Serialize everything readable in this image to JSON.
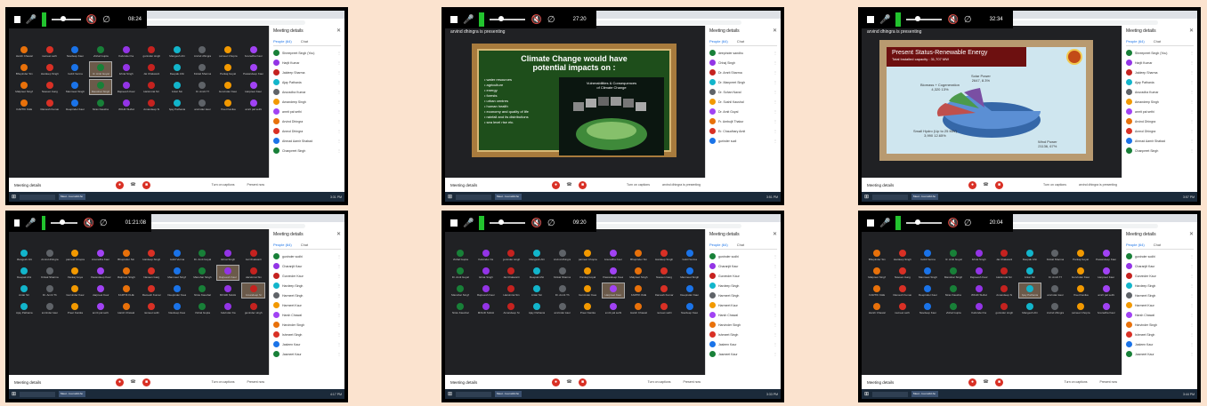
{
  "page": {
    "background": "#fbe3cf"
  },
  "browser": {
    "tab_title": "Meet - ku-nwdd-ho"
  },
  "common": {
    "meeting_details": "Meeting details",
    "people_tab": "People (64)",
    "chat_tab": "Chat",
    "turn_on_captions": "Turn on captions",
    "present_now": "Present now",
    "taskbar_app": "Meet - ku-nwdd-ho"
  },
  "screens": [
    {
      "id": "s1",
      "timer": "08:24",
      "time": "3:31 PM"
    },
    {
      "id": "s2",
      "timer": "27:20",
      "time": "3:51 PM",
      "presenter": "arvind dhingra is presenting",
      "presenting_label": "arvind dhingra is presenting"
    },
    {
      "id": "s3",
      "timer": "32:34",
      "time": "3:57 PM",
      "presenter": "arvind dhingra is presenting",
      "presenting_label": "arvind dhingra is presenting"
    },
    {
      "id": "s4",
      "timer": "01:21:08",
      "time": "4:17 PM"
    },
    {
      "id": "s5",
      "timer": "09:20",
      "time": "3:33 PM"
    },
    {
      "id": "s6",
      "timer": "20:04",
      "time": "3:44 PM"
    }
  ],
  "participants_grid": [
    "Harsh Chawal",
    "ravneet sethi",
    "Navdeep Kaur",
    "Vishal Gupta",
    "Kalvinder Ka",
    "guninder singh",
    "Mangesh Ahi",
    "Arvind dhingra",
    "parneet Chopra",
    "Anuradha Kaur",
    "Bhupinder Sin",
    "Hardeep Singh",
    "Gobil Verma",
    "Dr. Amit Goyal",
    "Ishrat Singh",
    "Jai Chakwarti",
    "Deepak Ahir",
    "Kinkal Sharma",
    "Pankaj Goyal",
    "Pawandeep Kaur",
    "Malpreet Singh",
    "Naveen Garg",
    "Manmeet Singh",
    "Manohar Singh",
    "Rajneesh Kaur",
    "Harsimrat Sin",
    "Antar Sin",
    "Dr. Amrit Th",
    "Gurvinder Kaur",
    "Harpreet Kaur",
    "KARTIK KHE",
    "Ramesh Kumar",
    "Deepinder Kaur",
    "Nirav Kaushal",
    "MOHD SHAH",
    "Amandeep Si",
    "Ajay Pathania",
    "amrinder kaur",
    "Preet Kanika",
    "amrit pal sethi"
  ],
  "sidebar_people": [
    "Shreepreet Singh (You)",
    "Harjit Kumar",
    "Jaideep Sharma",
    "Ajay Pathania",
    "Anuradha Kumar",
    "Amandeep Singh",
    "amrit pal sethi",
    "Arvind Dhingra",
    "Anmol Dhingra",
    "Ahmad Aamir Shabad",
    "Chanpreet Singh"
  ],
  "sidebar_people_s2": [
    "deepinder sandhu",
    "Chhaj Singh",
    "Dr. Amrit Sharma",
    "Dr. Manpreet Singh",
    "Dr. Sohan Naval",
    "Dr. Sushil Kaushal",
    "Dr. Amit Goyal",
    "Fr. Ambujit Thakur",
    "Er. Chaudhary Amit",
    "gurinder sudi"
  ],
  "sidebar_people_s5": [
    "guninder sodhi",
    "Charanjit Kaur",
    "Gurvinder Kaur",
    "Hardeep Singh",
    "Harmeet Singh",
    "Harmeet Kaur",
    "Harsh Chawal",
    "Harvinder Singh",
    "Ishmeet Singh",
    "Jasleen Kaur",
    "Jasmeet Kaur"
  ],
  "slide_climate": {
    "title_line1": "Climate Change would have",
    "title_line2": "potential  impacts on :",
    "items": [
      "water resources",
      "agriculture",
      "energy",
      "forests",
      "urban centres",
      "human health",
      "economy and quality of life",
      "rainfall and its distributions"
    ],
    "extra_item": "sea level rise etc.",
    "box_title_line1": "Vulnerabilities & Consequences",
    "box_title_line2": "of Climate Change"
  },
  "slide_energy": {
    "title": "Present Status-Renewable Energy",
    "subtitle": "Total Installed capacity : 31,707 MW",
    "labels": [
      {
        "text": "Solar Power",
        "value": "2647, 8.3%"
      },
      {
        "text": "Biomass + Cogeneration",
        "value": "4,320 13%"
      },
      {
        "text": "Small Hydro (Up to 25 MW)",
        "value": "3,990 12.65%"
      },
      {
        "text": "Wind Power",
        "value": "21136, 67%"
      }
    ]
  },
  "colors": {
    "red_button": "#d93025",
    "accent_blue": "#1a73e8",
    "recorder_green": "#22c32e"
  }
}
